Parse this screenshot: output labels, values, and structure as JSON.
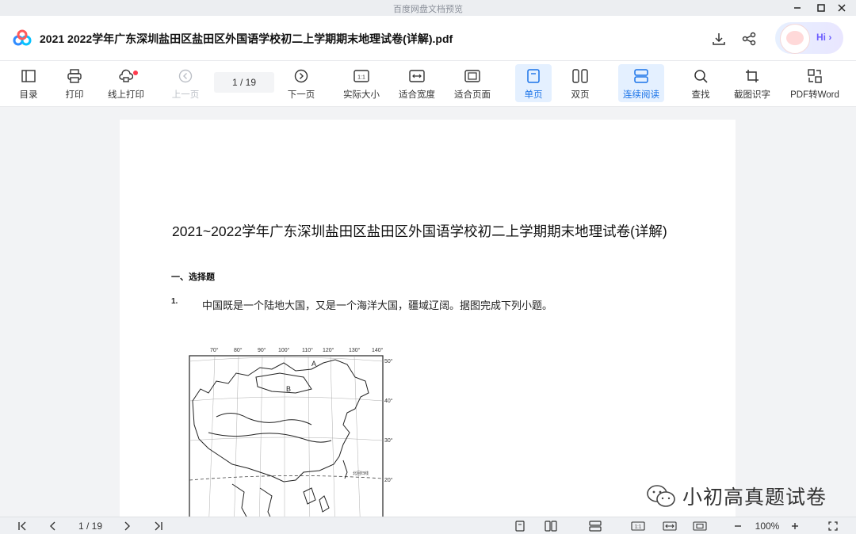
{
  "window": {
    "title": "百度网盘文档预览"
  },
  "header": {
    "doc_title": "2021 2022学年广东深圳盐田区盐田区外国语学校初二上学期期末地理试卷(详解).pdf",
    "hi_label": "Hi ›"
  },
  "toolbar": {
    "toc": "目录",
    "print": "打印",
    "online_print": "线上打印",
    "prev_page": "上一页",
    "page_indicator": "1  /  19",
    "next_page": "下一页",
    "actual_size": "实际大小",
    "fit_width": "适合宽度",
    "fit_page": "适合页面",
    "single_page": "单页",
    "double_page": "双页",
    "continuous": "连续阅读",
    "find": "查找",
    "ocr": "截图识字",
    "pdf_to_word": "PDF转Word"
  },
  "document": {
    "title": "2021~2022学年广东深圳盐田区盐田区外国语学校初二上学期期末地理试卷(详解)",
    "section": "一、选择题",
    "q_number": "1.",
    "q_text": "中国既是一个陆地大国，又是一个海洋大国，疆域辽阔。据图完成下列小题。",
    "map_lon": [
      "70°",
      "80°",
      "90°",
      "100°",
      "110°",
      "120°",
      "130°",
      "140°"
    ],
    "map_lat": [
      "50°",
      "40°",
      "30°",
      "20°"
    ],
    "map_letters": [
      "A",
      "B"
    ],
    "map_marks": [
      "北回归线"
    ]
  },
  "watermark": {
    "text": "小初高真题试卷"
  },
  "statusbar": {
    "page": "1 / 19",
    "zoom": "100%"
  }
}
